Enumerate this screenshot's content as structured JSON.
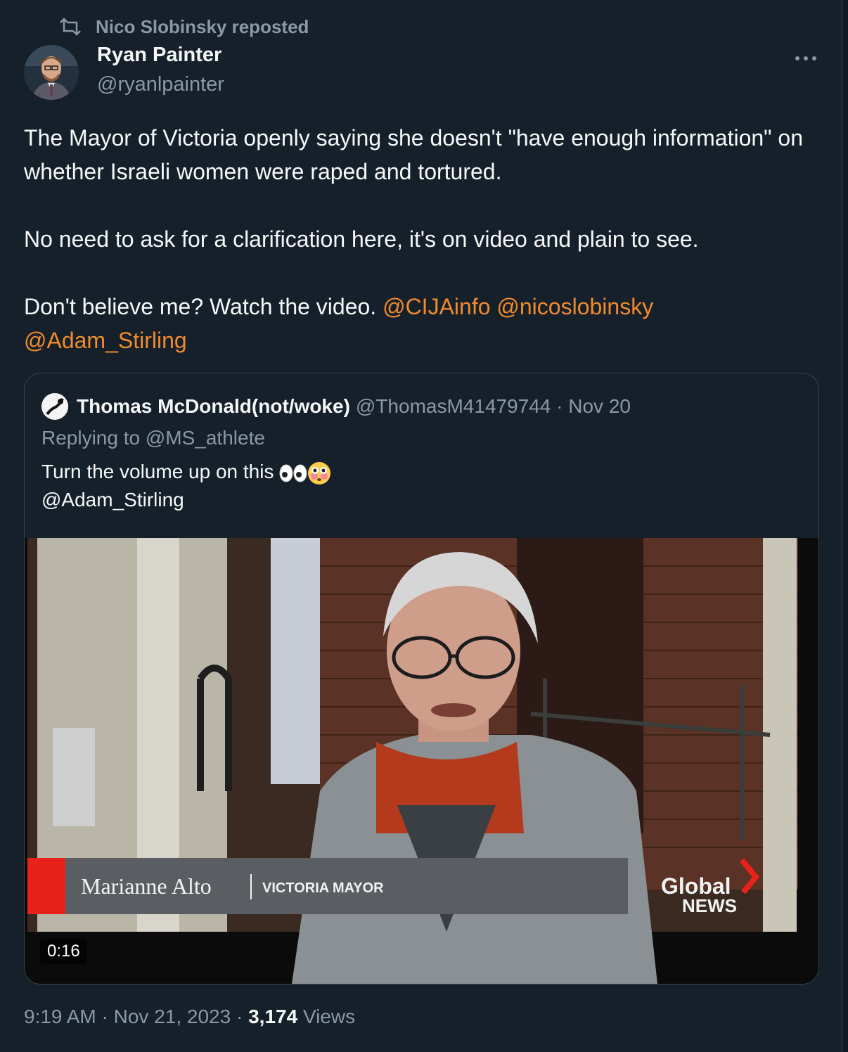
{
  "repost": {
    "label": "Nico Slobinsky reposted",
    "icon": "repost-icon"
  },
  "author": {
    "name": "Ryan Painter",
    "handle": "@ryanlpainter"
  },
  "tweet": {
    "line1": "The Mayor of Victoria openly saying she doesn't \"have enough information\" on whether Israeli women were raped and tortured.",
    "line2": "No need to ask for a clarification here, it's on video and plain to see.",
    "line3_text": "Don't believe me? Watch the video.",
    "mentions": [
      "@CIJAinfo",
      "@nicoslobinsky",
      "@Adam_Stirling"
    ]
  },
  "quote": {
    "name": "Thomas McDonald(not/woke)",
    "handle_date": "@ThomasM41479744 · Nov 20",
    "replying_to": "Replying to @MS_athlete",
    "text": "Turn the volume up on this",
    "emojis": [
      "eyes",
      "flushed-face"
    ],
    "mention": "@Adam_Stirling",
    "video": {
      "lower_third_name": "Marianne Alto",
      "lower_third_title": "VICTORIA MAYOR",
      "logo_line1": "Global",
      "logo_line2": "NEWS",
      "duration": "0:16"
    }
  },
  "footer": {
    "time": "9:19 AM",
    "sep": " · ",
    "date": "Nov 21, 2023",
    "views_count": "3,174",
    "views_label": "Views"
  },
  "colors": {
    "background": "#15202b",
    "accent": "#f18b2a",
    "muted": "#8b98a5",
    "text": "#f7f9f9",
    "border": "#38444d"
  }
}
